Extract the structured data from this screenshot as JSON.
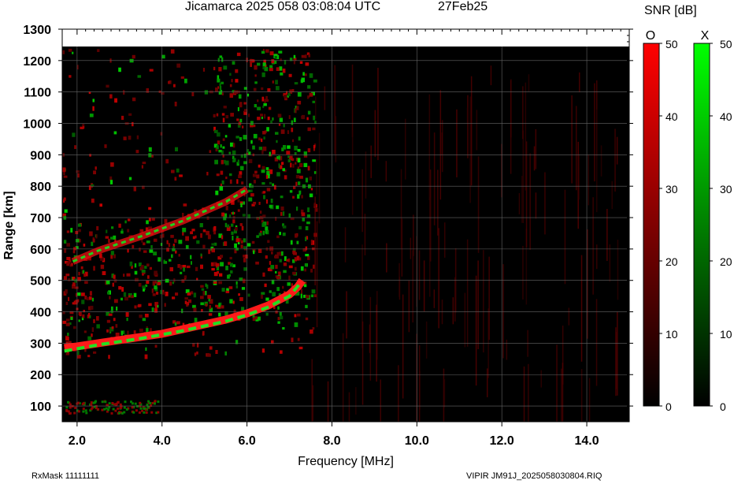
{
  "header": {
    "title": "Jicamarca 2025 058 03:08:04 UTC",
    "date": "27Feb25"
  },
  "colorbar": {
    "title": "SNR [dB]",
    "o_label": "O",
    "x_label": "X",
    "ticks": [
      "50",
      "40",
      "30",
      "20",
      "10",
      "0"
    ],
    "o_color": "#ff0000",
    "x_color": "#00ff00"
  },
  "footer": {
    "left": "RxMask 11111111",
    "right": "VIPIR  JM91J_2025058030804.RIQ"
  },
  "chart_data": {
    "type": "heatmap",
    "title": "Jicamarca 2025 058 03:08:04 UTC",
    "xlabel": "Frequency [MHz]",
    "ylabel": "Range [km]",
    "xlim": [
      1.65,
      15.0
    ],
    "ylim": [
      50,
      1300
    ],
    "xticks": [
      "2.0",
      "4.0",
      "6.0",
      "8.0",
      "10.0",
      "12.0",
      "14.0"
    ],
    "xtick_values": [
      2,
      4,
      6,
      8,
      10,
      12,
      14
    ],
    "yticks": [
      "100",
      "200",
      "300",
      "400",
      "500",
      "600",
      "700",
      "800",
      "900",
      "1000",
      "1100",
      "1200",
      "1300"
    ],
    "ytick_values": [
      100,
      200,
      300,
      400,
      500,
      600,
      700,
      800,
      900,
      1000,
      1100,
      1200,
      1300
    ],
    "grid": true,
    "colorscale": {
      "label": "SNR [dB]",
      "range": [
        0,
        50
      ]
    },
    "series": [
      {
        "mode": "O",
        "color": "#ff0000",
        "trace_first_hop": [
          [
            1.7,
            285
          ],
          [
            2.0,
            290
          ],
          [
            2.5,
            300
          ],
          [
            3.0,
            310
          ],
          [
            3.5,
            320
          ],
          [
            4.0,
            330
          ],
          [
            4.5,
            345
          ],
          [
            5.0,
            360
          ],
          [
            5.5,
            375
          ],
          [
            6.0,
            395
          ],
          [
            6.5,
            420
          ],
          [
            7.0,
            455
          ],
          [
            7.2,
            480
          ],
          [
            7.3,
            500
          ]
        ]
      },
      {
        "mode": "X",
        "color": "#00ff00",
        "trace_first_hop": [
          [
            1.7,
            275
          ],
          [
            2.5,
            295
          ],
          [
            3.5,
            315
          ],
          [
            4.5,
            340
          ],
          [
            5.5,
            370
          ],
          [
            6.0,
            390
          ],
          [
            6.5,
            415
          ],
          [
            7.0,
            450
          ],
          [
            7.25,
            490
          ]
        ]
      },
      {
        "mode": "O/X",
        "color": "#ff0000",
        "trace_second_hop": [
          [
            1.9,
            560
          ],
          [
            2.5,
            595
          ],
          [
            3.5,
            640
          ],
          [
            4.5,
            690
          ],
          [
            5.5,
            750
          ],
          [
            6.0,
            790
          ]
        ]
      }
    ]
  }
}
